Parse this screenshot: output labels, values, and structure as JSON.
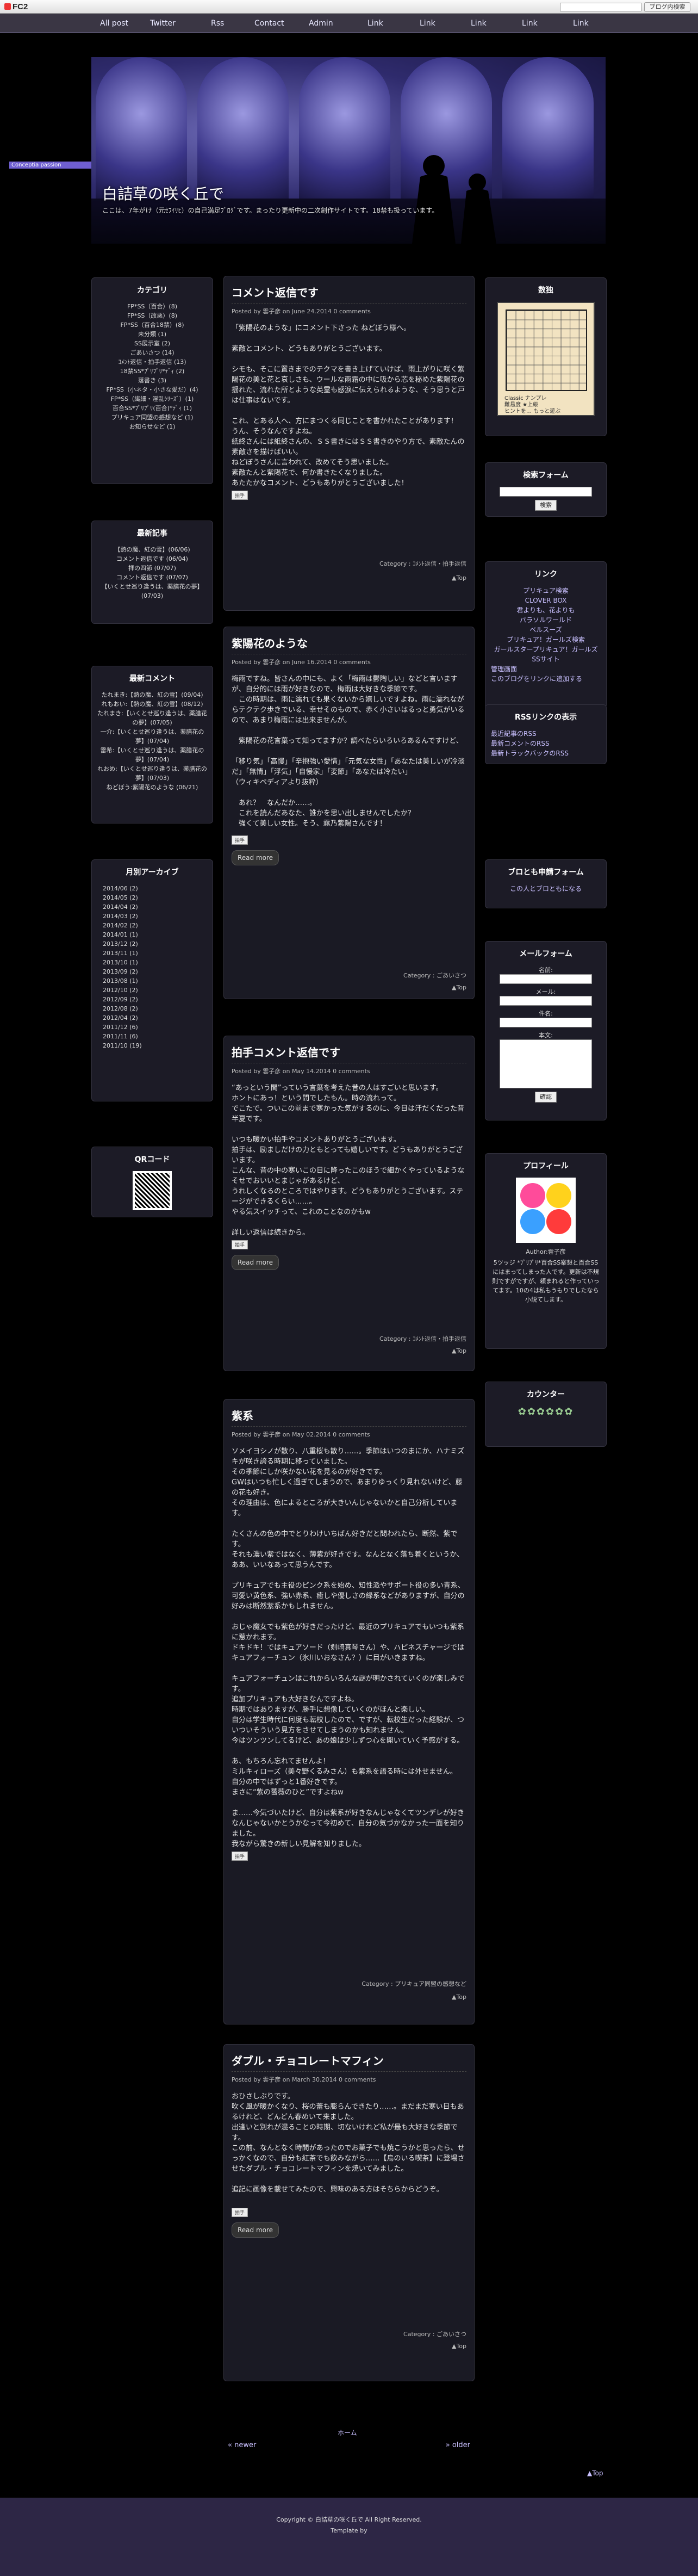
{
  "fc2": {
    "logo": "FC2",
    "login_button": "ブログ内検索"
  },
  "nav": [
    "All post",
    "Twitter",
    "Rss",
    "Contact",
    "Admin",
    "Link",
    "Link",
    "Link",
    "Link",
    "Link"
  ],
  "header": {
    "concept": "Conceptia passion",
    "title": "白詰草の咲く丘で",
    "desc": "ここは、7年がけ（元ｾﾌｲﾘﾋ）の自己満足ﾌﾞﾛｸﾞです。まったり更新中の二次創作サイトです。18禁も扱っています。"
  },
  "categories": {
    "title": "カテゴリ",
    "items": [
      "FP*SS（百合）(8)",
      "FP*SS（改悪）(8)",
      "FP*SS（百合18禁）(8)",
      "未分類 (1)",
      "SS展示室 (2)",
      "ごあいさつ (14)",
      "ｺﾒﾝﾄ返信・拍手返信 (13)",
      "18禁SS*ﾌﾟﾘﾌﾟﾘ*ﾃﾞｨ (2)",
      "落書き (3)",
      "FP*SS（小ネタ・小さな愛だ）(4)",
      "FP*SS（繊細・淫乱ｼﾘｰｽﾞ）(1)",
      "百合SS*ﾌﾟﾘﾌﾟﾘ(百合)*ﾃﾞｨ (1)",
      "プリキュア同盟の感想など (1)",
      "お知らせなど (1)"
    ]
  },
  "recent_articles": {
    "title": "最新記事",
    "items": [
      "【熱の魔、紅の雪】(06/06)",
      "コメント返信です (06/04)",
      "拝の四節 (07/07)",
      "コメント返信です (07/07)",
      "【いくとせ巡り逢うは、薬膳花の夢】(07/03)"
    ]
  },
  "recent_comments": {
    "title": "最新コメント",
    "items": [
      "たれまき:【熱の魔、紅の雪】(09/04)",
      "れもおい:【熱の魔、紅の雪】(08/12)",
      "たれまき:【いくとせ巡り逢うは、薬膳花の夢】(07/05)",
      "一介:【いくとせ巡り逢うは、薬膳花の夢】(07/04)",
      "雷希:【いくとせ巡り逢うは、薬膳花の夢】(07/04)",
      "れおめ:【いくとせ巡り逢うは、薬膳花の夢】(07/03)",
      "ねどぼう:紫陽花のような (06/21)"
    ]
  },
  "archives": {
    "title": "月別アーカイブ",
    "items": [
      "2014/06 (2)",
      "2014/05 (2)",
      "2014/04 (2)",
      "2014/03 (2)",
      "2014/02 (2)",
      "2014/01 (1)",
      "2013/12 (2)",
      "2013/11 (1)",
      "2013/10 (1)",
      "2013/09 (2)",
      "2013/08 (1)",
      "2012/10 (2)",
      "2012/09 (2)",
      "2012/08 (2)",
      "2012/04 (2)",
      "2011/12 (6)",
      "2011/11 (6)",
      "2011/10 (19)"
    ]
  },
  "qr": {
    "title": "QRコード"
  },
  "puzzle": {
    "title": "数独",
    "caption_lines": [
      "Classic ナンプレ",
      "難易度 ★上級",
      "ヒントを… もっと遊ぶ"
    ]
  },
  "search": {
    "title": "検索フォーム",
    "button": "検索"
  },
  "links": {
    "title": "リンク",
    "items": [
      "プリキュア検索",
      "CLOVER BOX",
      "君よりも、花よりも",
      "パラソルワールド",
      "ベルスーズ",
      "プリキュア！ガールズ検索",
      "ガールスタープリキュア！ガールズSSサイト",
      "管理画面",
      "このブログをリンクに追加する"
    ]
  },
  "rss": {
    "title": "RSSリンクの表示",
    "items": [
      "最近記事のRSS",
      "最新コメントのRSS",
      "最新トラックバックのRSS"
    ]
  },
  "friend": {
    "title": "ブロとも申請フォーム",
    "text": "この人とブロともになる"
  },
  "mailform": {
    "title": "メールフォーム",
    "name": "名前:",
    "mail": "メール:",
    "subject": "件名:",
    "body": "本文:",
    "button": "確認"
  },
  "profile": {
    "title": "プロフィール",
    "author": "Author:雲子彦",
    "text": "5ツッジ *ﾌﾟﾘﾌﾟﾘ*百合SS案想と百合SSにはまってしまった人です。更新は不規則ですがですが、頼まれると作っていってます。10の4は私もうもりでしたなら小説てします。"
  },
  "counter": {
    "title": "カウンター"
  },
  "entries": [
    {
      "title": "コメント返信です",
      "meta": "Posted by 雲子彦 on June 24.2014 0 comments",
      "body": "「紫陽花のような」にコメント下さった ねどぼう様へ。\n\n素敵とコメント、どうもありがとうございます。\n\nシモも、そこに置きまでのテクマを書き上げていけば、雨上がりに咲く紫陽花の美と花と哀しさも、ウールな雨霜の中に吸から芯を秘めた紫陽花の揺れた、流れた所とような英霊も感淚に伝えられるような、そう思うと戸は仕事はないです。\n\nこれ、とある人へ、方にまつくる同じことを書かれたことがあります！\nうん、そうなんですよね。\n紙終さんには紙終さんの、ＳＳ書きにはＳＳ書きのやり方で、素敵たんの素敵さを描けばいい。\nねどぼうさんに言われて、改めてそう思いました。\n素敵たんと紫陽花で、何か書きたくなりました。\nあたたかなコメント、どうもありがとうございました！",
      "category": "Category : ｺﾒﾝﾄ返信・拍手返信"
    },
    {
      "title": "紫陽花のような",
      "meta": "Posted by 雲子彦 on June 16.2014 0 comments",
      "body": "梅雨ですね。皆さんの中にも、よく「梅雨は鬱陶しい」などと言いますが、自分的には雨が好きなので、梅雨は大好きな季節です。\n　この時期は、雨に濡れても果くないから嬉しいですよね。雨に濡れながらテクテク歩きでいる、幸せそのもので、赤く小さいはるっと勇気がいるので、あまり梅雨には出来ませんが。\n\n　紫陽花の花言葉って知ってますか？調べたらいろいろあるんですけど、\n\n「移り気」「高慢」「辛抱強い愛情」「元気な女性」「あなたは美しいが冷淡だ」「無情」「浮気」「自慢家」「変節」「あなたは冷たい」\n（ウィキペディアより抜粋）\n\n　あれ？　なんだか……。\n　これを読んだあなた、誰かを思い出しませんでしたか？\n　強くて美しい女性。そう、霧乃紫陽さんです！",
      "more": "Read more",
      "category": "Category : ごあいさつ"
    },
    {
      "title": "拍手コメント返信です",
      "meta": "Posted by 雲子彦 on May 14.2014 0 comments",
      "body": "“あっという間”っていう言葉を考えた昔の人はすごいと思います。\nホントにあっ！という間でしたもん。時の流れって。\nでこたで。ついこの前まで寒かった気がするのに、今日は汗だくだった昔半夏です。\n\nいつも暖かい拍手やコメントありがとうございます。\n拍手は、励ましだけの力ともとっても嬉しいです。どうもありがとうございます。\nこんな、昔の中の寒いこの日に降ったこのほうで細かくやっているようなそせでおいいとまじゃがあるけど、\nうれしくなるのところではやります。どうもありがとうございます。ステージができるくらい……。\nやる気スイッチって、これのことなのかもw\n\n詳しい返信は続きから。",
      "more": "Read more",
      "category": "Category : ｺﾒﾝﾄ返信・拍手返信"
    },
    {
      "title": "紫系",
      "meta": "Posted by 雲子彦 on May 02.2014 0 comments",
      "body": "ソメイヨシノが散り、八重桜も散り……。季節はいつのまにか、ハナミズキが咲き誇る時期に移っていました。\nその季節にしか咲かない花を見るのが好きです。\nGWはいつも忙しく過ぎてしまうので、あまりゆっくり見れないけど、藤の花も好き。\nその理由は、色によるところが大きいんじゃないかと自己分析しています。\n\nたくさんの色の中でとりわけいちばん好きだと問われたら、断然、紫です。\nそれも濃い紫ではなく、薄紫が好きです。なんとなく落ち着くというか、ああ、いいなあって思うんです。\n\nプリキュアでも主役のピンク系を始め、知性派やサポート役の多い青系、可愛い黄色系、強い赤系、癒しや優しさの緑系などがありますが、自分の好みは断然紫系かもしれません。\n\nおじゃ魔女でも紫色が好きだったけど、最近のプリキュアでもいつも紫系に惹かれます。\nドキドキ！ではキュアソード（剣崎真琴さん）や、ハピネスチャージではキュアフォーチュン（氷川いおなさん？）に目がいきますね。\n\nキュアフォーチュンはこれからいろんな謎が明かされていくのが楽しみです。\n追加プリキュアも大好きなんですよね。\n時期ではありますが、勝手に想像していくのがほんと楽しい。\n自分は学生時代に何度も転校したので、ですが、転校生だった経験が、ついついそういう見方をさせてしまうのかも知れません。\n今はツンツンしてるけど、あの娘は少しずつ心を開いていく予感がする。\n\nあ、もちろん忘れてませんよ！\nミルキィローズ（美々野くるみさん）も紫系を語る時には外せません。\n自分の中ではずっと1番好きです。\nまさに“紫の薔薇のひと”ですよねw\n\nま……今気づいたけど、自分は紫系が好きなんじゃなくてツンデレが好きなんじゃないかとうかなって今初めて、自分の気づかなかった一面を知りました。\n我ながら驚きの新しい見解を知りました。",
      "category": "Category : プリキュア同盟の感想など"
    },
    {
      "title": "ダブル・チョコレートマフィン",
      "meta": "Posted by 雲子彦 on March 30.2014 0 comments",
      "body": "おひさしぶりです。\n吹く風が暖かくなり、桜の蕾も膨らんできたり……。まだまだ寒い日もあるけれど、どんどん春めいて来ました。\n出逢いと別れが混ることの時期、切ないけれど私が最も大好きな季節です。\nこの前、なんとなく時間があったのでお菓子でも焼こうかと思ったら、せっかくなので、自分も紅茶でも飲みながら……【鳥のいる喫茶】に登場させたダブル・チョコレートマフィンを焼いてみました。\n\n追記に画像を載せてみたので、興味のある方はそちらからどうぞ。",
      "more": "Read more",
      "category": "Category : ごあいさつ"
    }
  ],
  "pager": {
    "home": "ホーム",
    "prev": "« newer",
    "next": "» older"
  },
  "toplink": "▲Top",
  "footer": {
    "copyright": "Copyright © 白詰草の咲く丘で All Right Reserved.",
    "template": "Template by"
  }
}
